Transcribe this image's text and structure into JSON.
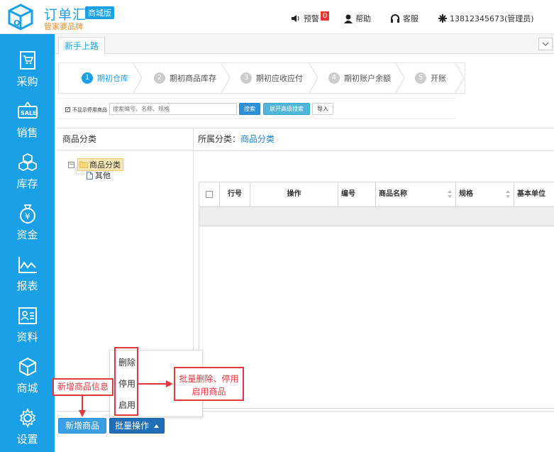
{
  "header": {
    "brand_name": "订单汇",
    "brand_badge": "商城版",
    "brand_sub": "管家婆品牌",
    "warning_label": "预警",
    "warning_count": "0",
    "help_label": "帮助",
    "service_label": "客服",
    "user_label": "13812345673(管理员)"
  },
  "sidebar": {
    "items": [
      {
        "label": "采购",
        "icon": "cart-icon"
      },
      {
        "label": "销售",
        "icon": "sale-tag-icon"
      },
      {
        "label": "库存",
        "icon": "boxes-icon"
      },
      {
        "label": "资金",
        "icon": "money-bag-icon"
      },
      {
        "label": "报表",
        "icon": "line-chart-icon"
      },
      {
        "label": "资料",
        "icon": "id-card-icon"
      },
      {
        "label": "商城",
        "icon": "cube-icon"
      },
      {
        "label": "设置",
        "icon": "gear-icon"
      }
    ]
  },
  "tabs": [
    {
      "label": "新手上路"
    }
  ],
  "steps": [
    {
      "num": "1",
      "label": "期初仓库",
      "active": true
    },
    {
      "num": "2",
      "label": "期初商品库存",
      "active": false
    },
    {
      "num": "3",
      "label": "期初应收应付",
      "active": false
    },
    {
      "num": "4",
      "label": "期初账户余额",
      "active": false
    },
    {
      "num": "5",
      "label": "开账",
      "active": false
    }
  ],
  "toolbar": {
    "hide_disabled_label": "不显示停用商品",
    "search_placeholder": "搜索编号、名称、规格",
    "search_button": "搜索",
    "expand_search_button": "展开高级搜索",
    "import_button": "导入"
  },
  "left_panel": {
    "title": "商品分类",
    "tree_root": "商品分类",
    "tree_child": "其他"
  },
  "right_panel": {
    "crumb_prefix": "所属分类：",
    "crumb_link": "商品分类",
    "columns": [
      "行号",
      "操作",
      "编号",
      "商品名称",
      "规格",
      "基本单位"
    ]
  },
  "menu": {
    "items": [
      "删除",
      "停用",
      "启用"
    ]
  },
  "callouts": {
    "batch_note_line1": "批量删除、停用",
    "batch_note_line2": "启用商品",
    "add_note": "新增商品信息"
  },
  "buttons": {
    "add_product": "新增商品",
    "batch_ops": "批量操作"
  },
  "colors": {
    "brand": "#1aa0e6",
    "accent_orange": "#f08a23",
    "annotation_red": "#e0393e"
  }
}
